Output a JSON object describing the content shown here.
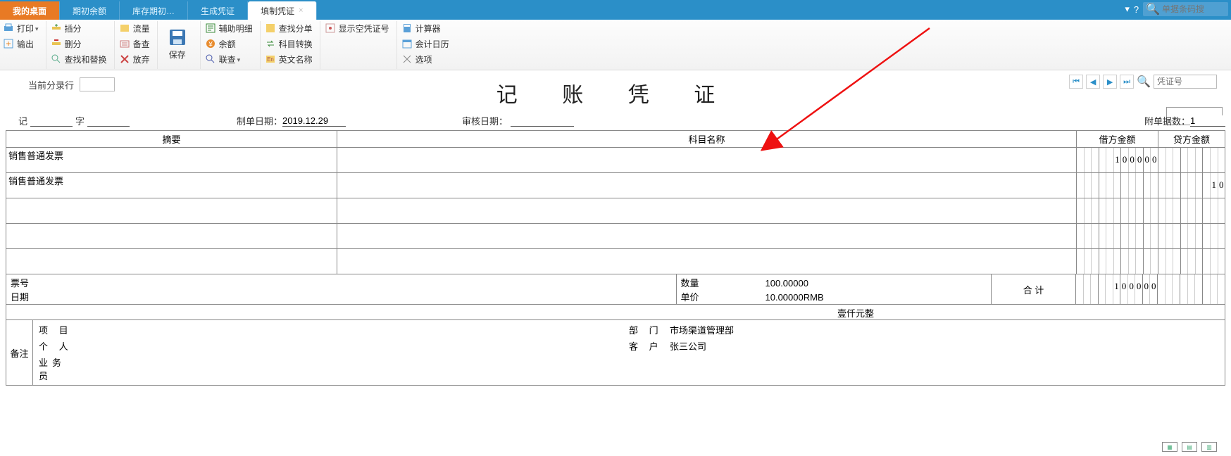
{
  "tabs": {
    "home": "我的桌面",
    "t1": "期初余额",
    "t2": "库存期初…",
    "t3": "生成凭证",
    "active": "填制凭证"
  },
  "topsearch_placeholder": "单据条码搜",
  "ribbon": {
    "print": "打印",
    "output": "输出",
    "insert": "插分",
    "delete": "删分",
    "findreplace": "查找和替换",
    "flow": "流量",
    "backup": "备查",
    "discard": "放弃",
    "save": "保存",
    "aux": "辅助明细",
    "balance": "余额",
    "lookup": "联查",
    "findsplit": "查找分单",
    "transfer": "科目转换",
    "english": "英文名称",
    "showempty": "显示空凭证号",
    "calc": "计算器",
    "caldate": "会计日历",
    "options": "选项"
  },
  "cur_row_label": "当前分录行",
  "nav_placeholder": "凭证号",
  "title": "记 账 凭 证",
  "header": {
    "ji": "记",
    "zi": "字",
    "make_date_label": "制单日期：",
    "make_date": "2019.12.29",
    "audit_date_label": "审核日期：",
    "attach_label": "附单据数：",
    "attach": "1"
  },
  "cols": {
    "summary": "摘要",
    "subject": "科目名称",
    "debit": "借方金额",
    "credit": "贷方金额"
  },
  "rows": [
    {
      "summary": "销售普通发票",
      "subject": "",
      "debit": "100000",
      "credit": ""
    },
    {
      "summary": "销售普通发票",
      "subject": "",
      "debit": "",
      "credit": "10"
    },
    {
      "summary": "",
      "subject": "",
      "debit": "",
      "credit": ""
    },
    {
      "summary": "",
      "subject": "",
      "debit": "",
      "credit": ""
    },
    {
      "summary": "",
      "subject": "",
      "debit": "",
      "credit": ""
    }
  ],
  "meta": {
    "billno_label": "票号",
    "date_label": "日期",
    "qty_label": "数量",
    "qty": "100.00000",
    "price_label": "单价",
    "price": "10.00000RMB",
    "sum_label": "合 计",
    "sum_debit": "100000",
    "sum_cn": "壹仟元整"
  },
  "notes": {
    "label": "备注",
    "project_k": "项 目",
    "project_v": "",
    "person_k": "个 人",
    "person_v": "",
    "sales_k": "业务员",
    "sales_v": "",
    "dept_k": "部 门",
    "dept_v": "市场渠道管理部",
    "cust_k": "客 户",
    "cust_v": "张三公司"
  }
}
